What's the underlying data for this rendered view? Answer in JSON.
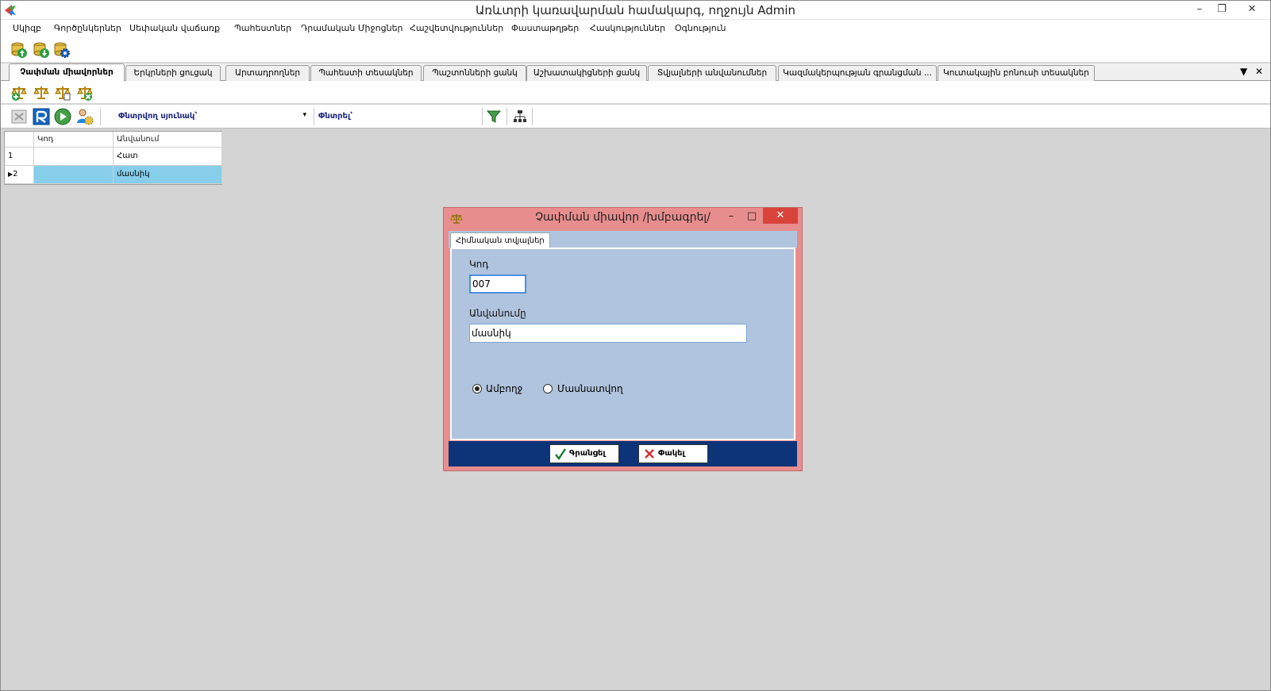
{
  "window": {
    "title": "Առևտրի կառավարման համակարգ, ողջույն Admin"
  },
  "menu": [
    "Սկիզբ",
    "Գործընկերներ",
    "Սեփական վաճառք",
    "Պահեստներ",
    "Դրամական Միջոցներ",
    "Հաշվետվություններ",
    "Փաստաթղթեր",
    "Հասկություններ",
    "Օգնություն"
  ],
  "tabs": [
    {
      "label": "Չափման միավորներ",
      "active": true
    },
    {
      "label": "Երկրների ցուցակ"
    },
    {
      "label": "Արտադրողներ"
    },
    {
      "label": "Պահեստի տեսակներ"
    },
    {
      "label": "Պաշտոնների ցանկ"
    },
    {
      "label": "Աշխատակիցների ցանկ"
    },
    {
      "label": "Տվյալների անվանումներ"
    },
    {
      "label": "Կազմակերպության գրանցման ..."
    },
    {
      "label": "Կուտակային բոնուսի տեսակներ"
    }
  ],
  "filter": {
    "search_column_label": "Փնտրվող սյունակ՝",
    "search_label": "Փնտրել՝"
  },
  "grid": {
    "columns": [
      "Կոդ",
      "Անվանում"
    ],
    "rows": [
      {
        "num": "1",
        "code": "",
        "name": "Հատ"
      },
      {
        "num": "2",
        "code": "",
        "name": "մասնիկ"
      }
    ]
  },
  "dialog": {
    "title": "Չափման միավոր /խմբագրել/",
    "tab": "Հիմնական տվյալներ",
    "code_label": "Կոդ",
    "code_value": "007",
    "name_label": "Անվանումը",
    "name_value": "մասնիկ",
    "radio_whole": "Ամբողջ",
    "radio_partial": "Մասնատվող",
    "save_label": "Գրանցել",
    "close_label": "Փակել"
  },
  "colors": {
    "dialog_frame": "#e88d8d",
    "dialog_body": "#b0c4de",
    "dialog_footer": "#0d3478",
    "selected_row": "#87ceeb",
    "close_button": "#d9443a"
  }
}
